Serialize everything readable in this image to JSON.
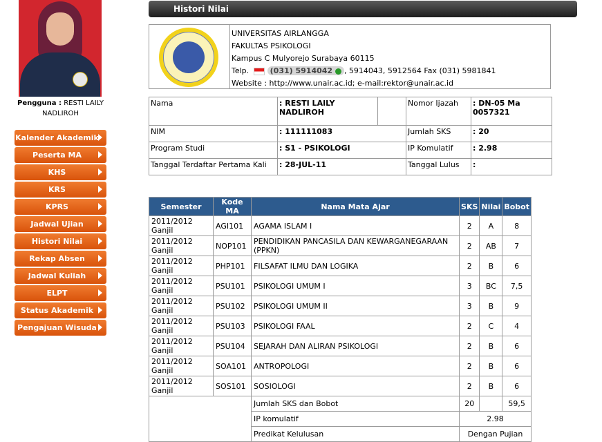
{
  "sidebar": {
    "user_prefix": "Pengguna :",
    "user_name_line1": "RESTI LAILY",
    "user_name_line2": "NADLIROH",
    "items": [
      {
        "label": "Kalender Akademik"
      },
      {
        "label": "Peserta MA"
      },
      {
        "label": "KHS"
      },
      {
        "label": "KRS"
      },
      {
        "label": "KPRS"
      },
      {
        "label": "Jadwal Ujian"
      },
      {
        "label": "Histori Nilai"
      },
      {
        "label": "Rekap Absen"
      },
      {
        "label": "Jadwal Kuliah"
      },
      {
        "label": "ELPT"
      },
      {
        "label": "Status Akademik"
      },
      {
        "label": "Pengajuan Wisuda"
      }
    ]
  },
  "header": {
    "title": "Histori Nilai"
  },
  "university": {
    "name": "UNIVERSITAS AIRLANGGA",
    "faculty": "FAKULTAS PSIKOLOGI",
    "address": "Kampus C Mulyorejo Surabaya 60115",
    "telp_label": "Telp.",
    "telp_main": "(031) 5914042",
    "telp_rest": ", 5914043, 5912564 Fax (031) 5981841",
    "website": "Website : http://www.unair.ac.id; e-mail:rektor@unair.ac.id"
  },
  "student": {
    "nama_label": "Nama",
    "nama_value": ": RESTI LAILY NADLIROH",
    "ijazah_label": "Nomor Ijazah",
    "ijazah_value": ": DN-05 Ma 0057321",
    "nim_label": "NIM",
    "nim_value": ": 111111083",
    "sks_label": "Jumlah SKS",
    "sks_value": ": 20",
    "prodi_label": "Program Studi",
    "prodi_value": ": S1 - PSIKOLOGI",
    "ipk_label": "IP Komulatif",
    "ipk_value": ": 2.98",
    "tgl_daftar_label": "Tanggal Terdaftar Pertama Kali",
    "tgl_daftar_value": ": 28-JUL-11",
    "tgl_lulus_label": "Tanggal Lulus",
    "tgl_lulus_value": ":"
  },
  "grades": {
    "headers": [
      "Semester",
      "Kode MA",
      "Nama Mata Ajar",
      "SKS",
      "Nilai",
      "Bobot"
    ],
    "rows": [
      [
        "2011/2012 Ganjil",
        "AGI101",
        "AGAMA ISLAM I",
        "2",
        "A",
        "8"
      ],
      [
        "2011/2012 Ganjil",
        "NOP101",
        "PENDIDIKAN PANCASILA DAN KEWARGANEGARAAN (PPKN)",
        "2",
        "AB",
        "7"
      ],
      [
        "2011/2012 Ganjil",
        "PHP101",
        "FILSAFAT ILMU DAN LOGIKA",
        "2",
        "B",
        "6"
      ],
      [
        "2011/2012 Ganjil",
        "PSU101",
        "PSIKOLOGI UMUM I",
        "3",
        "BC",
        "7,5"
      ],
      [
        "2011/2012 Ganjil",
        "PSU102",
        "PSIKOLOGI UMUM II",
        "3",
        "B",
        "9"
      ],
      [
        "2011/2012 Ganjil",
        "PSU103",
        "PSIKOLOGI FAAL",
        "2",
        "C",
        "4"
      ],
      [
        "2011/2012 Ganjil",
        "PSU104",
        "SEJARAH DAN ALIRAN PSIKOLOGI",
        "2",
        "B",
        "6"
      ],
      [
        "2011/2012 Ganjil",
        "SOA101",
        "ANTROPOLOGI",
        "2",
        "B",
        "6"
      ],
      [
        "2011/2012 Ganjil",
        "SOS101",
        "SOSIOLOGI",
        "2",
        "B",
        "6"
      ]
    ],
    "summary": {
      "jumlah_label": "Jumlah SKS dan Bobot",
      "jumlah_sks": "20",
      "jumlah_bobot": "59,5",
      "ip_label": "IP komulatif",
      "ip_value": "2.98",
      "predikat_label": "Predikat Kelulusan",
      "predikat_value": "Dengan Pujian"
    }
  }
}
